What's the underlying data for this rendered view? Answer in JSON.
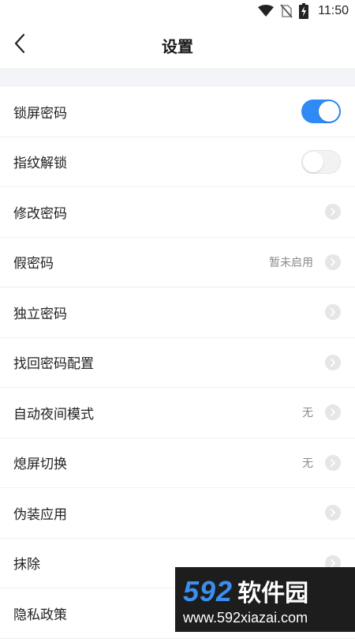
{
  "status_bar": {
    "time": "11:50",
    "icons": [
      "wifi-icon",
      "no-sim-icon",
      "battery-charging-icon"
    ]
  },
  "app_bar": {
    "title": "设置",
    "back_icon": "chevron-left-icon"
  },
  "settings": [
    {
      "label": "锁屏密码",
      "control": "toggle",
      "on": true
    },
    {
      "label": "指纹解锁",
      "control": "toggle",
      "on": false
    },
    {
      "label": "修改密码",
      "control": "chevron",
      "value": ""
    },
    {
      "label": "假密码",
      "control": "chevron",
      "value": "暂未启用"
    },
    {
      "label": "独立密码",
      "control": "chevron",
      "value": ""
    },
    {
      "label": "找回密码配置",
      "control": "chevron",
      "value": ""
    },
    {
      "label": "自动夜间模式",
      "control": "chevron",
      "value": "无"
    },
    {
      "label": "熄屏切换",
      "control": "chevron",
      "value": "无"
    },
    {
      "label": "伪装应用",
      "control": "chevron",
      "value": ""
    },
    {
      "label": "抹除",
      "control": "chevron",
      "value": ""
    },
    {
      "label": "隐私政策",
      "control": "chevron",
      "value": ""
    }
  ],
  "colors": {
    "accent": "#2f8af5",
    "band": "#f3f4f8",
    "text": "#222222",
    "muted": "#8a8a8a"
  },
  "watermark": {
    "number": "592",
    "name": "软件园",
    "url": "www.592xiazai.com"
  }
}
